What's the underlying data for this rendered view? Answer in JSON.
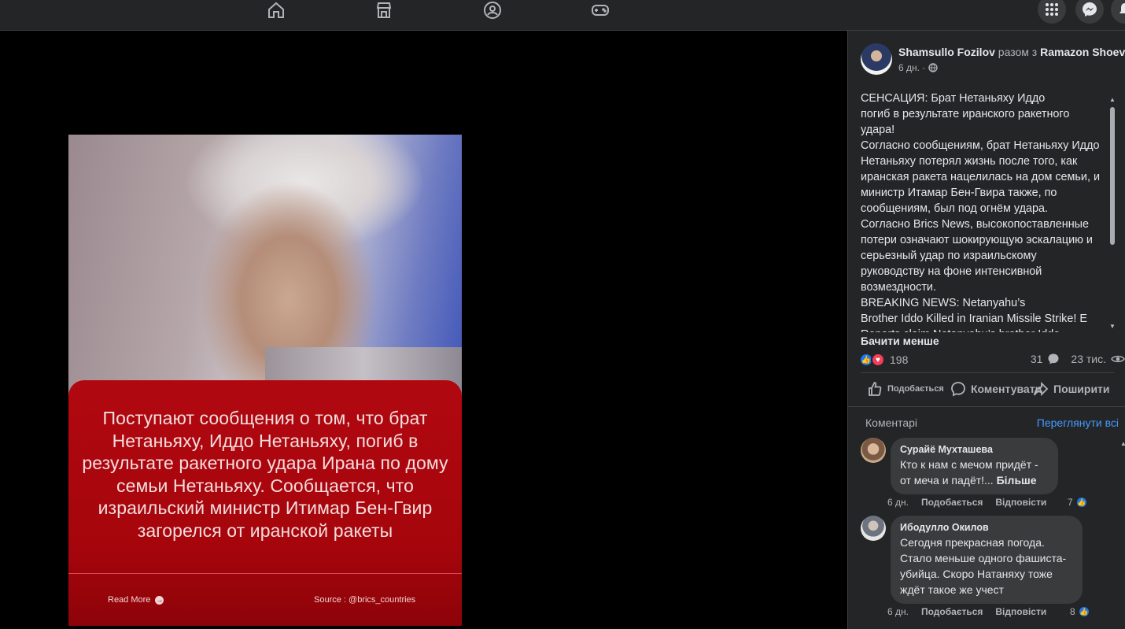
{
  "post": {
    "author": "Shamsullo Fozilov",
    "with_text": "разом з",
    "coauthor": "Ramazon Shoev",
    "time": "6 дн. ·",
    "text": "СЕНСАЦИЯ: Брат Нетаньяху Иддо\nпогиб в результате иранского ракетного\nудара!\nСогласно сообщениям, брат Нетаньяху Иддо\nНетаньяху потерял жизнь после того, как\nиранская ракета нацелилась на дом семьи, и\nминистр Итамар Бен-Гвира также, по\nсообщениям, был под огнём удара.\nСогласно Brics News, высокопоставленные\nпотери означают шокирующую эскалацию и\nсерьезный удар по израильскому\nруководству на фоне интенсивной\nвозмездности.\nBREAKING NEWS: Netanyahu’s\nBrother Iddo Killed in Iranian Missile Strike! E\nReports claim Netanyahu’s brother Iddo",
    "see_less": "Бачити менше",
    "reaction_count": "198",
    "comment_count": "31",
    "view_count": "23 тис.",
    "actions": {
      "like": "Подобається",
      "comment": "Коментувати",
      "share": "Поширити"
    }
  },
  "image_card": {
    "text": "Поступают сообщения о том, что брат Нетаньяху, Иддо Нетаньяху, погиб в результате ракетного удара Ирана по дому семьи Нетаньяху. Сообщается, что израильский министр Итимар Бен-Гвир загорелся от иранской ракеты",
    "read_more": "Read More",
    "source": "Source : @brics_countries"
  },
  "comments_section": {
    "title": "Коментарі",
    "see_all": "Переглянути всі",
    "items": [
      {
        "name": "Сурайё Мухташева",
        "text": "Кто к нам с мечом придёт -\nот меча и падёт!...",
        "more": "Більше",
        "time": "6 дн.",
        "like": "Подобається",
        "reply": "Відповісти",
        "likes": "7"
      },
      {
        "name": "Ибодулло Окилов",
        "text": "Сегодня прекрасная погода.\nСтало меньше одного фашиста-\nубийца. Скоро Натаняху тоже\nждёт такое же учест",
        "time": "6 дн.",
        "like": "Подобається",
        "reply": "Відповісти",
        "likes": "8"
      }
    ]
  },
  "icons": {
    "nav": [
      "home-icon",
      "marketplace-icon",
      "groups-icon",
      "gaming-icon"
    ],
    "right": [
      "apps-grid-icon",
      "messenger-icon",
      "notifications-icon"
    ]
  },
  "colors": {
    "panel_bg": "#242526",
    "accent": "#1877f2",
    "link": "#4599ff",
    "card_red": "#b0060e"
  }
}
